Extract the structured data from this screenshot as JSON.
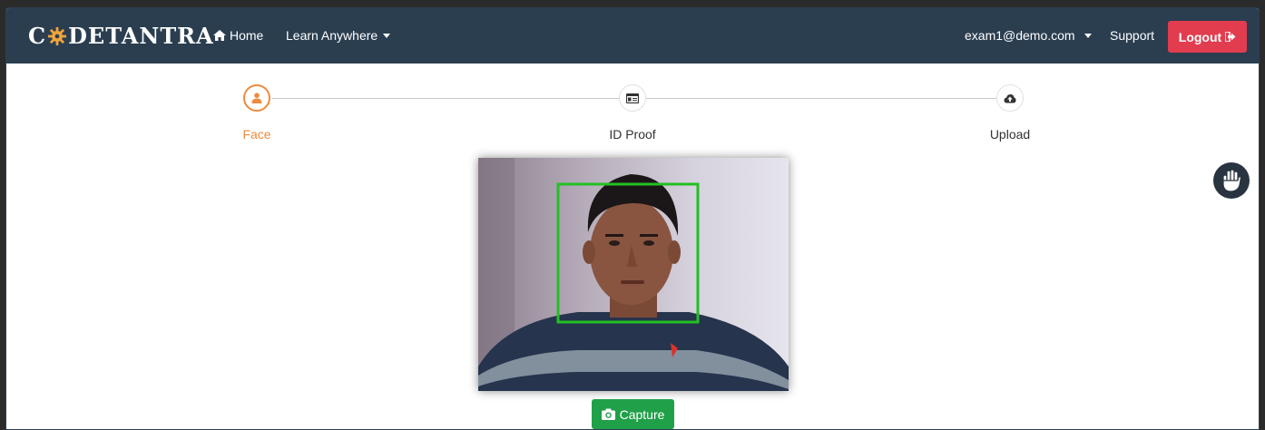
{
  "navbar": {
    "brand_prefix": "C",
    "brand_suffix": "DETANTRA",
    "home_label": "Home",
    "learn_label": "Learn Anywhere",
    "user_email": "exam1@demo.com",
    "support_label": "Support",
    "logout_label": "Logout"
  },
  "steps": [
    {
      "label": "Face",
      "icon": "user-icon",
      "state": "active"
    },
    {
      "label": "ID Proof",
      "icon": "id-card-icon",
      "state": "inactive"
    },
    {
      "label": "Upload",
      "icon": "cloud-upload-icon",
      "state": "inactive"
    }
  ],
  "camera": {
    "face_detected": true
  },
  "capture_label": "Capture",
  "colors": {
    "navbar_bg": "#2b3e50",
    "active_step": "#ee8a3c",
    "logout_bg": "#e23c4f",
    "capture_bg": "#20a048",
    "face_box": "#22c022"
  }
}
